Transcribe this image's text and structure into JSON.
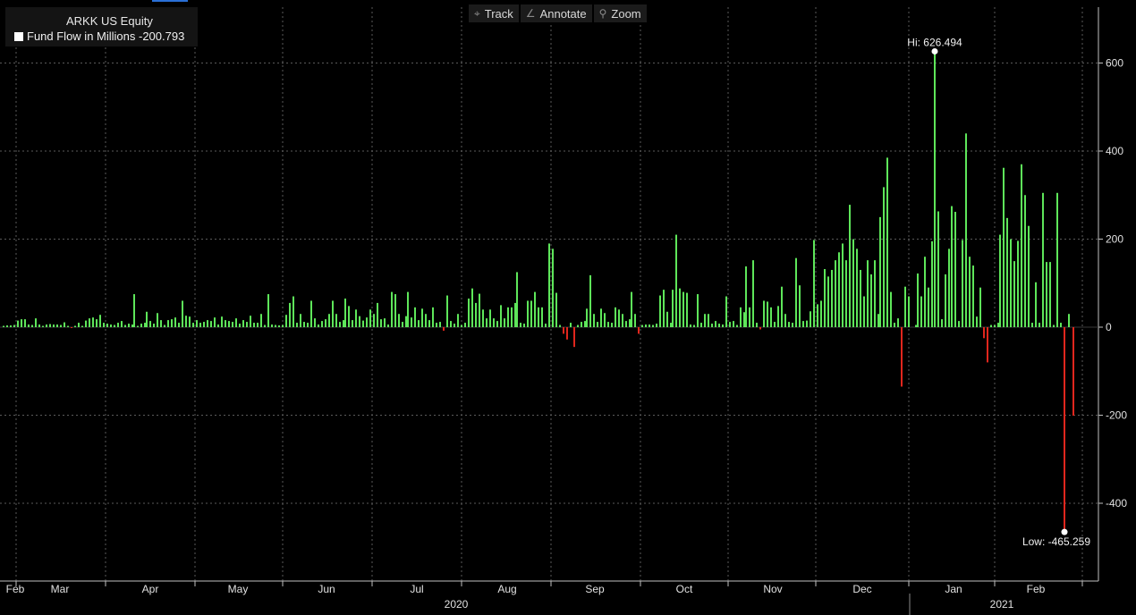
{
  "legend": {
    "title": "ARKK US Equity",
    "series_label": "Fund Flow in Millions",
    "series_value": "-200.793"
  },
  "toolbar": {
    "track_label": "Track",
    "annotate_label": "Annotate",
    "zoom_label": "Zoom"
  },
  "annotations": {
    "high_label": "Hi: 626.494",
    "low_label": "Low: -465.259"
  },
  "colors": {
    "positive": "#5ee65a",
    "negative": "#e0261d",
    "background": "#000000",
    "grid": "#5a5a5a"
  },
  "chart_data": {
    "type": "bar",
    "title": "ARKK US Equity",
    "series": [
      {
        "name": "Fund Flow in Millions"
      }
    ],
    "ylim": [
      -520,
      720
    ],
    "yticks": [
      600,
      400,
      200,
      0,
      -200,
      -400
    ],
    "ytick_labels": [
      "600",
      "400",
      "200",
      "0",
      "-200",
      "-400"
    ],
    "xlim": [
      0,
      1228
    ],
    "grid": true,
    "y_axis_side": "right",
    "month_ticks": [
      {
        "label": "Feb",
        "at": 17
      },
      {
        "label": "Mar",
        "at": 67
      },
      {
        "label": "Apr",
        "at": 168
      },
      {
        "label": "May",
        "at": 266
      },
      {
        "label": "Jun",
        "at": 365
      },
      {
        "label": "Jul",
        "at": 466
      },
      {
        "label": "Aug",
        "at": 567
      },
      {
        "label": "Sep",
        "at": 665
      },
      {
        "label": "Oct",
        "at": 765
      },
      {
        "label": "Nov",
        "at": 864
      },
      {
        "label": "Dec",
        "at": 964
      },
      {
        "label": "Jan",
        "at": 1066
      },
      {
        "label": "Feb",
        "at": 1158
      }
    ],
    "month_grid": [
      18,
      118,
      218,
      316,
      416,
      516,
      616,
      716,
      814,
      912,
      1016,
      1112,
      1210
    ],
    "years": [
      {
        "label": "2020",
        "at": 510
      },
      {
        "label": "2021",
        "at": 1120
      }
    ],
    "year_divider": 1017,
    "high": {
      "value": 626.494,
      "at": 1045
    },
    "low": {
      "value": -465.259,
      "at": 1190
    },
    "bars": [
      [
        4,
        3
      ],
      [
        8,
        4
      ],
      [
        12,
        4
      ],
      [
        16,
        5
      ],
      [
        20,
        15
      ],
      [
        24,
        18
      ],
      [
        28,
        18
      ],
      [
        32,
        6
      ],
      [
        36,
        5
      ],
      [
        40,
        20
      ],
      [
        44,
        6
      ],
      [
        48,
        3
      ],
      [
        52,
        6
      ],
      [
        56,
        7
      ],
      [
        60,
        6
      ],
      [
        64,
        6
      ],
      [
        68,
        5
      ],
      [
        72,
        11
      ],
      [
        76,
        3
      ],
      [
        80,
        -2
      ],
      [
        84,
        3
      ],
      [
        88,
        10
      ],
      [
        92,
        3
      ],
      [
        96,
        15
      ],
      [
        100,
        20
      ],
      [
        104,
        22
      ],
      [
        108,
        18
      ],
      [
        112,
        28
      ],
      [
        116,
        10
      ],
      [
        120,
        8
      ],
      [
        124,
        6
      ],
      [
        128,
        5
      ],
      [
        132,
        10
      ],
      [
        136,
        14
      ],
      [
        140,
        5
      ],
      [
        144,
        8
      ],
      [
        148,
        6
      ],
      [
        150,
        75
      ],
      [
        154,
        3
      ],
      [
        158,
        8
      ],
      [
        162,
        10
      ],
      [
        164,
        35
      ],
      [
        168,
        14
      ],
      [
        172,
        8
      ],
      [
        176,
        32
      ],
      [
        180,
        16
      ],
      [
        184,
        5
      ],
      [
        188,
        16
      ],
      [
        192,
        18
      ],
      [
        196,
        22
      ],
      [
        200,
        10
      ],
      [
        204,
        60
      ],
      [
        208,
        26
      ],
      [
        212,
        24
      ],
      [
        216,
        10
      ],
      [
        220,
        16
      ],
      [
        224,
        10
      ],
      [
        228,
        12
      ],
      [
        232,
        16
      ],
      [
        236,
        14
      ],
      [
        240,
        22
      ],
      [
        244,
        6
      ],
      [
        248,
        24
      ],
      [
        252,
        16
      ],
      [
        256,
        14
      ],
      [
        260,
        12
      ],
      [
        264,
        20
      ],
      [
        268,
        8
      ],
      [
        272,
        16
      ],
      [
        276,
        12
      ],
      [
        280,
        26
      ],
      [
        284,
        10
      ],
      [
        288,
        10
      ],
      [
        292,
        30
      ],
      [
        296,
        5
      ],
      [
        300,
        75
      ],
      [
        304,
        6
      ],
      [
        308,
        5
      ],
      [
        312,
        4
      ],
      [
        316,
        5
      ],
      [
        320,
        28
      ],
      [
        324,
        55
      ],
      [
        328,
        70
      ],
      [
        332,
        10
      ],
      [
        336,
        30
      ],
      [
        340,
        12
      ],
      [
        344,
        10
      ],
      [
        348,
        60
      ],
      [
        352,
        20
      ],
      [
        356,
        6
      ],
      [
        360,
        14
      ],
      [
        364,
        18
      ],
      [
        368,
        30
      ],
      [
        372,
        60
      ],
      [
        376,
        30
      ],
      [
        380,
        12
      ],
      [
        384,
        16
      ],
      [
        386,
        65
      ],
      [
        390,
        48
      ],
      [
        394,
        16
      ],
      [
        398,
        40
      ],
      [
        402,
        25
      ],
      [
        406,
        15
      ],
      [
        410,
        22
      ],
      [
        414,
        40
      ],
      [
        418,
        30
      ],
      [
        422,
        55
      ],
      [
        426,
        18
      ],
      [
        430,
        20
      ],
      [
        434,
        6
      ],
      [
        438,
        80
      ],
      [
        442,
        75
      ],
      [
        446,
        30
      ],
      [
        450,
        12
      ],
      [
        454,
        25
      ],
      [
        456,
        80
      ],
      [
        460,
        22
      ],
      [
        464,
        45
      ],
      [
        468,
        16
      ],
      [
        472,
        42
      ],
      [
        476,
        30
      ],
      [
        480,
        16
      ],
      [
        484,
        45
      ],
      [
        488,
        10
      ],
      [
        492,
        12
      ],
      [
        496,
        -8
      ],
      [
        500,
        72
      ],
      [
        504,
        14
      ],
      [
        508,
        8
      ],
      [
        512,
        30
      ],
      [
        516,
        5
      ],
      [
        520,
        10
      ],
      [
        524,
        65
      ],
      [
        528,
        88
      ],
      [
        532,
        55
      ],
      [
        536,
        76
      ],
      [
        540,
        40
      ],
      [
        544,
        20
      ],
      [
        548,
        40
      ],
      [
        552,
        20
      ],
      [
        556,
        14
      ],
      [
        560,
        50
      ],
      [
        564,
        20
      ],
      [
        568,
        45
      ],
      [
        572,
        45
      ],
      [
        576,
        55
      ],
      [
        578,
        125
      ],
      [
        582,
        10
      ],
      [
        586,
        8
      ],
      [
        590,
        60
      ],
      [
        594,
        60
      ],
      [
        598,
        80
      ],
      [
        602,
        45
      ],
      [
        606,
        45
      ],
      [
        610,
        8
      ],
      [
        614,
        190
      ],
      [
        618,
        178
      ],
      [
        622,
        78
      ],
      [
        626,
        5
      ],
      [
        630,
        -15
      ],
      [
        634,
        -28
      ],
      [
        638,
        10
      ],
      [
        642,
        -45
      ],
      [
        646,
        5
      ],
      [
        650,
        12
      ],
      [
        654,
        14
      ],
      [
        656,
        42
      ],
      [
        660,
        118
      ],
      [
        664,
        30
      ],
      [
        668,
        12
      ],
      [
        672,
        42
      ],
      [
        676,
        32
      ],
      [
        680,
        12
      ],
      [
        684,
        10
      ],
      [
        688,
        45
      ],
      [
        692,
        40
      ],
      [
        696,
        30
      ],
      [
        700,
        14
      ],
      [
        704,
        18
      ],
      [
        706,
        80
      ],
      [
        710,
        30
      ],
      [
        714,
        -15
      ],
      [
        718,
        5
      ],
      [
        722,
        6
      ],
      [
        726,
        6
      ],
      [
        730,
        5
      ],
      [
        734,
        8
      ],
      [
        738,
        72
      ],
      [
        742,
        85
      ],
      [
        746,
        35
      ],
      [
        750,
        10
      ],
      [
        752,
        85
      ],
      [
        756,
        210
      ],
      [
        760,
        88
      ],
      [
        764,
        80
      ],
      [
        768,
        78
      ],
      [
        772,
        6
      ],
      [
        776,
        5
      ],
      [
        780,
        75
      ],
      [
        784,
        10
      ],
      [
        788,
        30
      ],
      [
        792,
        30
      ],
      [
        796,
        8
      ],
      [
        800,
        14
      ],
      [
        804,
        8
      ],
      [
        808,
        6
      ],
      [
        812,
        70
      ],
      [
        816,
        12
      ],
      [
        820,
        14
      ],
      [
        824,
        5
      ],
      [
        828,
        45
      ],
      [
        832,
        34
      ],
      [
        834,
        138
      ],
      [
        838,
        45
      ],
      [
        842,
        152
      ],
      [
        846,
        10
      ],
      [
        850,
        -5
      ],
      [
        854,
        60
      ],
      [
        858,
        58
      ],
      [
        862,
        45
      ],
      [
        866,
        12
      ],
      [
        870,
        48
      ],
      [
        874,
        92
      ],
      [
        878,
        30
      ],
      [
        882,
        12
      ],
      [
        886,
        10
      ],
      [
        890,
        157
      ],
      [
        894,
        95
      ],
      [
        898,
        14
      ],
      [
        902,
        15
      ],
      [
        906,
        36
      ],
      [
        910,
        198
      ],
      [
        914,
        52
      ],
      [
        918,
        60
      ],
      [
        922,
        132
      ],
      [
        926,
        115
      ],
      [
        930,
        130
      ],
      [
        934,
        152
      ],
      [
        938,
        170
      ],
      [
        942,
        190
      ],
      [
        946,
        152
      ],
      [
        950,
        278
      ],
      [
        954,
        200
      ],
      [
        958,
        178
      ],
      [
        962,
        130
      ],
      [
        966,
        70
      ],
      [
        970,
        152
      ],
      [
        974,
        120
      ],
      [
        978,
        152
      ],
      [
        982,
        30
      ],
      [
        984,
        250
      ],
      [
        988,
        318
      ],
      [
        992,
        385
      ],
      [
        996,
        80
      ],
      [
        1000,
        10
      ],
      [
        1004,
        20
      ],
      [
        1008,
        -135
      ],
      [
        1012,
        92
      ],
      [
        1016,
        70
      ],
      [
        1024,
        5
      ],
      [
        1026,
        122
      ],
      [
        1030,
        70
      ],
      [
        1034,
        160
      ],
      [
        1038,
        90
      ],
      [
        1042,
        195
      ],
      [
        1045,
        626
      ],
      [
        1049,
        263
      ],
      [
        1053,
        18
      ],
      [
        1057,
        120
      ],
      [
        1061,
        178
      ],
      [
        1064,
        275
      ],
      [
        1068,
        262
      ],
      [
        1072,
        14
      ],
      [
        1076,
        198
      ],
      [
        1080,
        440
      ],
      [
        1084,
        160
      ],
      [
        1088,
        140
      ],
      [
        1092,
        24
      ],
      [
        1096,
        90
      ],
      [
        1100,
        -25
      ],
      [
        1104,
        -80
      ],
      [
        1108,
        5
      ],
      [
        1112,
        5
      ],
      [
        1116,
        10
      ],
      [
        1118,
        210
      ],
      [
        1122,
        362
      ],
      [
        1126,
        248
      ],
      [
        1130,
        200
      ],
      [
        1134,
        150
      ],
      [
        1138,
        196
      ],
      [
        1142,
        370
      ],
      [
        1146,
        300
      ],
      [
        1150,
        230
      ],
      [
        1154,
        10
      ],
      [
        1158,
        102
      ],
      [
        1162,
        10
      ],
      [
        1166,
        305
      ],
      [
        1170,
        148
      ],
      [
        1174,
        148
      ],
      [
        1178,
        5
      ],
      [
        1182,
        305
      ],
      [
        1186,
        10
      ],
      [
        1190,
        -465
      ],
      [
        1195,
        30
      ],
      [
        1200,
        -201
      ]
    ]
  }
}
